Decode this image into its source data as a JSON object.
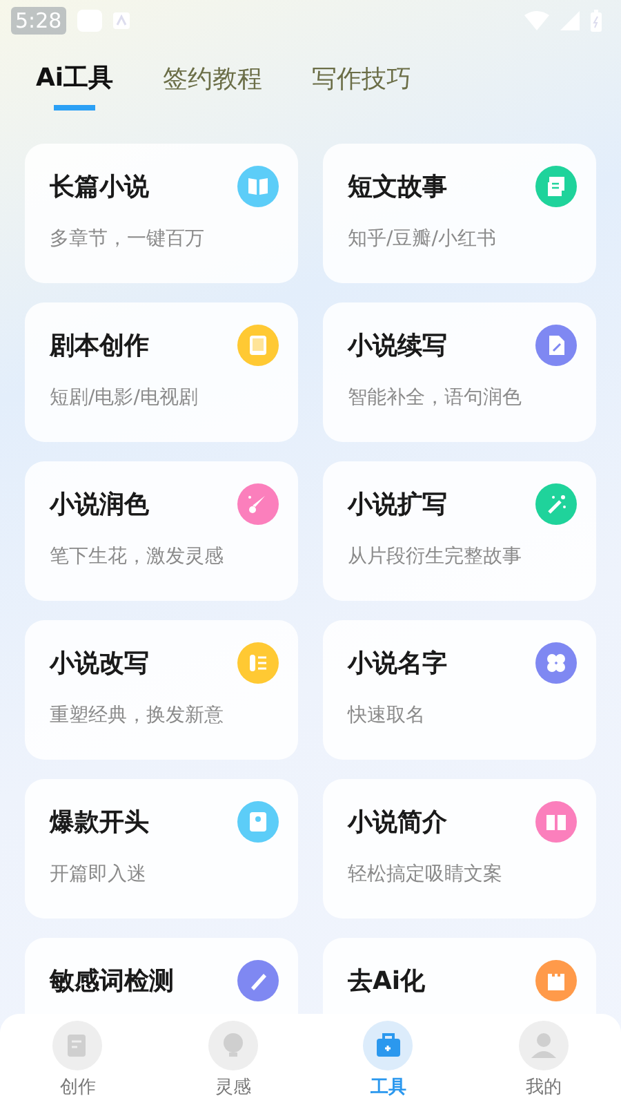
{
  "status_bar": {
    "time": "5:28"
  },
  "tabs": [
    {
      "label": "Ai工具",
      "selected": true
    },
    {
      "label": "签约教程",
      "selected": false
    },
    {
      "label": "写作技巧",
      "selected": false
    }
  ],
  "tools": [
    {
      "title": "长篇小说",
      "subtitle": "多章节，一键百万",
      "kind": "book",
      "color": "#5ccdf8"
    },
    {
      "title": "短文故事",
      "subtitle": "知乎/豆瓣/小红书",
      "kind": "scroll",
      "color": "#1fd39b"
    },
    {
      "title": "剧本创作",
      "subtitle": "短剧/电影/电视剧",
      "kind": "tablet",
      "color": "#ffc933"
    },
    {
      "title": "小说续写",
      "subtitle": "智能补全，语句润色",
      "kind": "file-pen",
      "color": "#7f88f2"
    },
    {
      "title": "小说润色",
      "subtitle": "笔下生花，激发灵感",
      "kind": "brush",
      "color": "#fb7fbc"
    },
    {
      "title": "小说扩写",
      "subtitle": "从片段衍生完整故事",
      "kind": "wand",
      "color": "#1fd39b"
    },
    {
      "title": "小说改写",
      "subtitle": "重塑经典，换发新意",
      "kind": "list",
      "color": "#ffc933"
    },
    {
      "title": "小说名字",
      "subtitle": "快速取名",
      "kind": "clover",
      "color": "#7f88f2"
    },
    {
      "title": "爆款开头",
      "subtitle": "开篇即入迷",
      "kind": "book-star",
      "color": "#5ccdf8"
    },
    {
      "title": "小说简介",
      "subtitle": "轻松搞定吸睛文案",
      "kind": "open-book",
      "color": "#fb7fbc"
    },
    {
      "title": "敏感词检测",
      "kind": "pen",
      "color": "#7f88f2"
    },
    {
      "title": "去Ai化",
      "kind": "castle",
      "color": "#ff9a4a"
    }
  ],
  "bottom_nav": [
    {
      "label": "创作",
      "kind": "edit",
      "selected": false
    },
    {
      "label": "灵感",
      "kind": "bulb",
      "selected": false
    },
    {
      "label": "工具",
      "kind": "toolbox",
      "selected": true
    },
    {
      "label": "我的",
      "kind": "person",
      "selected": false
    }
  ]
}
